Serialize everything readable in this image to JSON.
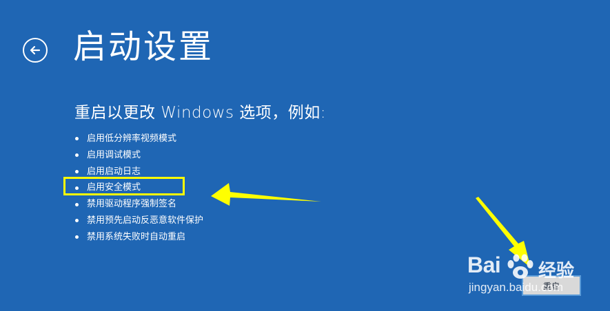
{
  "header": {
    "title": "启动设置",
    "back_icon": "back-arrow-icon"
  },
  "main": {
    "subtitle": "重启以更改 Windows 选项，例如:",
    "options": [
      "启用低分辨率视频模式",
      "启用调试模式",
      "启用启动日志",
      "启用安全模式",
      "禁用驱动程序强制签名",
      "禁用预先启动反恶意软件保护",
      "禁用系统失败时自动重启"
    ],
    "highlighted_option_index": 3
  },
  "footer": {
    "restart_label": "重启"
  },
  "annotation": {
    "color": "#ffff00"
  },
  "watermark": {
    "logo_text": "Bai",
    "logo_suffix": "经验",
    "url": "jingyan.baidu.com"
  },
  "colors": {
    "background": "#1f66b4",
    "text": "#ffffff",
    "highlight": "#ffff00"
  }
}
